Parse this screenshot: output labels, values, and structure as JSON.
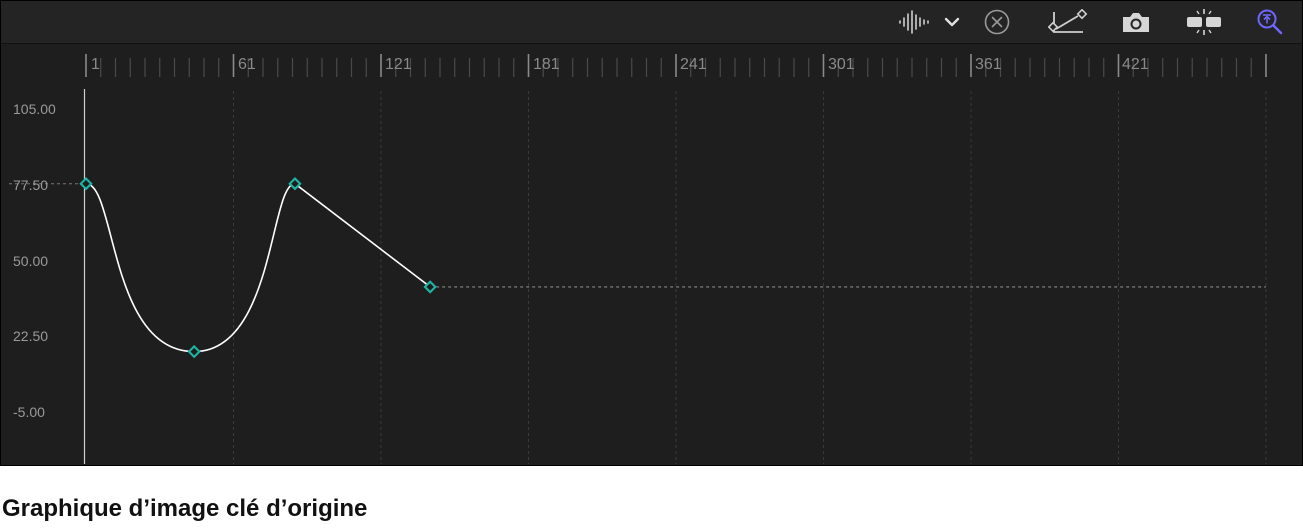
{
  "toolbar": {
    "buttons": [
      {
        "icon": "audio-waveform-icon"
      },
      {
        "icon": "chevron-down-icon"
      },
      {
        "icon": "clear-curve-icon"
      },
      {
        "icon": "curve-edit-icon"
      },
      {
        "icon": "camera-snapshot-icon"
      },
      {
        "icon": "split-frame-icon"
      },
      {
        "icon": "zoom-to-fit-icon"
      }
    ],
    "active_color": "#6e66ff"
  },
  "ruler": {
    "frames": [
      "1",
      "61",
      "121",
      "181",
      "241",
      "301",
      "361",
      "421"
    ]
  },
  "chart_data": {
    "type": "line",
    "x_axis": "frames",
    "xlim": [
      1,
      481
    ],
    "ylim": [
      -5,
      105
    ],
    "y_ticks": [
      "105.00",
      "77.50",
      "50.00",
      "22.50",
      "-5.00"
    ],
    "keyframes": [
      {
        "frame": 1,
        "value": 77.5,
        "interp": "smooth"
      },
      {
        "frame": 45,
        "value": 16.5,
        "interp": "smooth"
      },
      {
        "frame": 86,
        "value": 77.5,
        "interp": "linear"
      },
      {
        "frame": 141,
        "value": 40
      },
      {
        "frame": 481,
        "value": 40,
        "extrapolated": true
      }
    ],
    "reference_value": 77.5,
    "playhead_frame": 0,
    "curve_color": "#ffffff",
    "keyframe_color": "#1fb5a6",
    "grid": true
  },
  "caption": "Graphique d’image clé d’origine"
}
